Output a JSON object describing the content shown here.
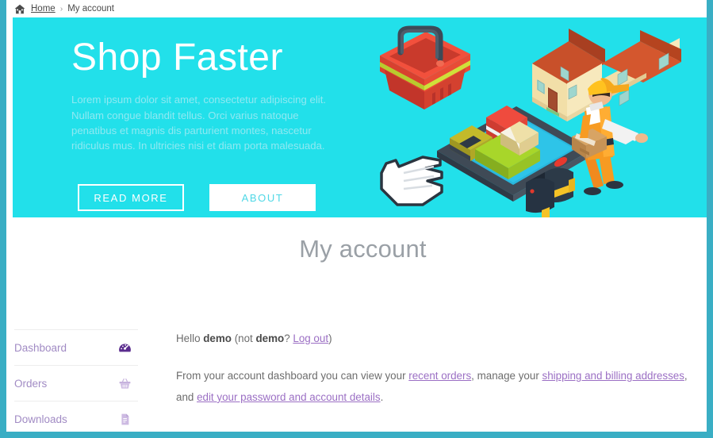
{
  "breadcrumb": {
    "home_icon": "home-icon",
    "home_label": "Home",
    "separator": "›",
    "current": "My account"
  },
  "hero": {
    "title": "Shop Faster",
    "subtitle": "Lorem ipsum dolor sit amet, consectetur adipiscing elit. Nullam congue blandit tellus. Orci varius natoque penatibus et magnis dis parturient montes, nascetur ridiculus mus. In ultricies nisi et diam porta malesuada.",
    "primary_button": "READ MORE",
    "secondary_button": "ABOUT",
    "background_color": "#22e0ea",
    "illustration": [
      "shopping-basket-icon",
      "house-icon",
      "tablet-with-parcels-icon",
      "pointer-hand-cursor-icon",
      "mailbox-icon",
      "delivery-person-icon"
    ]
  },
  "page": {
    "title": "My account",
    "frame_color": "#3aaec4"
  },
  "account_nav": {
    "items": [
      {
        "label": "Dashboard",
        "icon": "dashboard-gauge-icon",
        "active": true
      },
      {
        "label": "Orders",
        "icon": "basket-icon",
        "active": false
      },
      {
        "label": "Downloads",
        "icon": "file-download-icon",
        "active": false
      }
    ]
  },
  "content": {
    "greeting": {
      "hello": "Hello ",
      "user": "demo",
      "not_open": " (not ",
      "not_user": "demo",
      "q": "? ",
      "logout": "Log out",
      "close": ")"
    },
    "intro": {
      "p1": "From your account dashboard you can view your ",
      "link1": "recent orders",
      "p2": ", manage your ",
      "link2": "shipping and billing addresses",
      "p3": ", and ",
      "link3": "edit your password and account details",
      "p4": "."
    },
    "link_color": "#9b6fc4"
  }
}
